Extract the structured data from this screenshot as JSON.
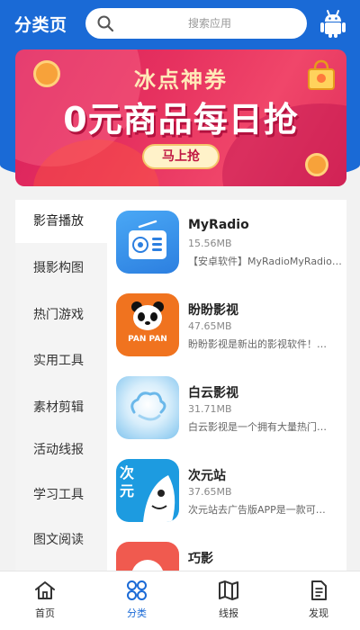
{
  "header": {
    "title": "分类页",
    "search_placeholder": "搜索应用"
  },
  "banner": {
    "subtitle": "冰点神券",
    "headline": "0元商品每日抢",
    "button_label": "马上抢"
  },
  "categories": [
    {
      "label": "影音播放",
      "active": true
    },
    {
      "label": "摄影构图",
      "active": false
    },
    {
      "label": "热门游戏",
      "active": false
    },
    {
      "label": "实用工具",
      "active": false
    },
    {
      "label": "素材剪辑",
      "active": false
    },
    {
      "label": "活动线报",
      "active": false
    },
    {
      "label": "学习工具",
      "active": false
    },
    {
      "label": "图文阅读",
      "active": false
    }
  ],
  "apps": [
    {
      "name": "MyRadio",
      "size": "15.56MB",
      "desc": "【安卓软件】MyRadioMyRadio…",
      "icon": "radio-icon"
    },
    {
      "name": "盼盼影视",
      "size": "47.65MB",
      "desc": "盼盼影视是新出的影视软件！…",
      "icon": "panda-icon",
      "icon_text": "PAN PAN"
    },
    {
      "name": "白云影视",
      "size": "31.71MB",
      "desc": "白云影视是一个拥有大量热门…",
      "icon": "cloud-icon"
    },
    {
      "name": "次元站",
      "size": "37.65MB",
      "desc": "次元站去广告版APP是一款可…",
      "icon": "anime-icon",
      "icon_text": "次元"
    },
    {
      "name": "巧影",
      "size": "",
      "desc": "",
      "icon": "kinemaster-icon"
    }
  ],
  "tabs": [
    {
      "label": "首页",
      "icon": "home-icon",
      "active": false
    },
    {
      "label": "分类",
      "icon": "grid-icon",
      "active": true
    },
    {
      "label": "线报",
      "icon": "map-icon",
      "active": false
    },
    {
      "label": "发现",
      "icon": "document-icon",
      "active": false
    }
  ],
  "colors": {
    "primary": "#1a6ad6",
    "banner": "#e6315f"
  }
}
